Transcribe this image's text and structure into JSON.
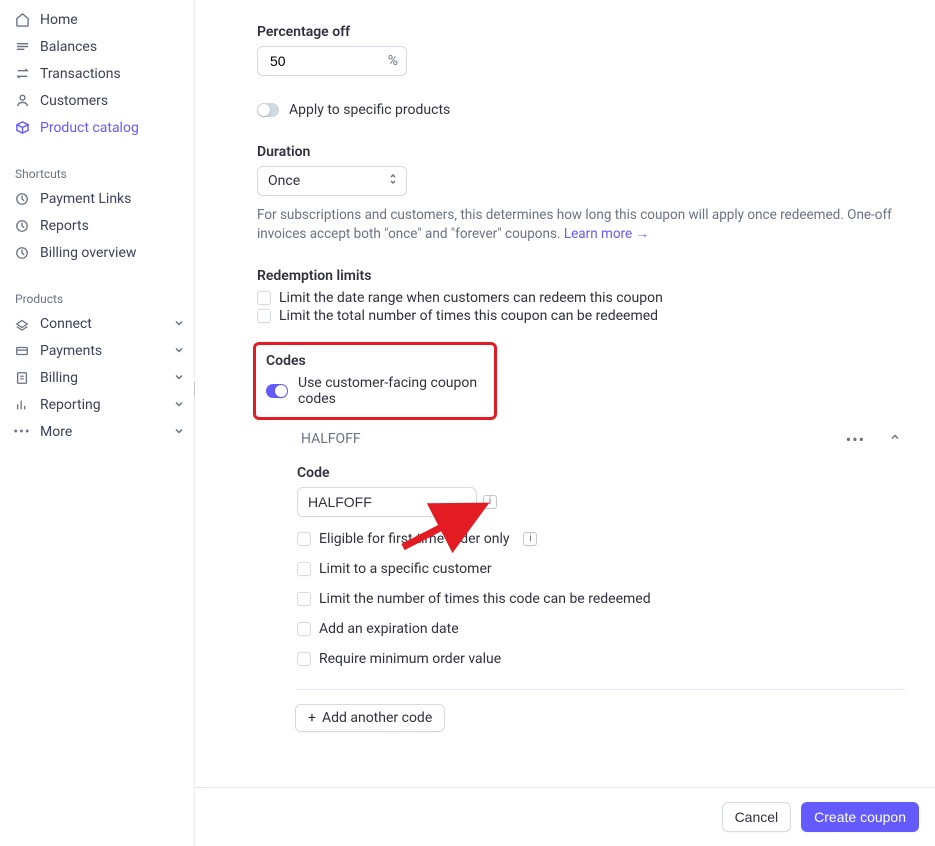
{
  "sidebar": {
    "nav": [
      {
        "label": "Home",
        "icon": "home-icon"
      },
      {
        "label": "Balances",
        "icon": "balances-icon"
      },
      {
        "label": "Transactions",
        "icon": "transactions-icon"
      },
      {
        "label": "Customers",
        "icon": "customers-icon"
      },
      {
        "label": "Product catalog",
        "icon": "product-catalog-icon",
        "active": true
      }
    ],
    "shortcuts_label": "Shortcuts",
    "shortcuts": [
      {
        "label": "Payment Links",
        "icon": "clock-icon"
      },
      {
        "label": "Reports",
        "icon": "clock-icon"
      },
      {
        "label": "Billing overview",
        "icon": "clock-icon"
      }
    ],
    "products_label": "Products",
    "products": [
      {
        "label": "Connect",
        "icon": "connect-icon"
      },
      {
        "label": "Payments",
        "icon": "payments-icon"
      },
      {
        "label": "Billing",
        "icon": "billing-icon"
      },
      {
        "label": "Reporting",
        "icon": "reporting-icon"
      },
      {
        "label": "More",
        "icon": "more-icon"
      }
    ]
  },
  "form": {
    "percentage_label": "Percentage off",
    "percentage_value": "50",
    "percentage_suffix": "%",
    "apply_specific_label": "Apply to specific products",
    "duration_label": "Duration",
    "duration_value": "Once",
    "duration_help_a": "For subscriptions and customers, this determines how long this coupon will apply once redeemed. One-off invoices accept both \"once\" and \"forever\" coupons.",
    "duration_help_link": "Learn more",
    "redemption_label": "Redemption limits",
    "redemption_cb1": "Limit the date range when customers can redeem this coupon",
    "redemption_cb2": "Limit the total number of times this coupon can be redeemed",
    "codes_label": "Codes",
    "codes_toggle_label": "Use customer-facing coupon codes",
    "code_item_name": "HALFOFF",
    "code_field_label": "Code",
    "code_value": "HALFOFF",
    "code_cb1": "Eligible for first-time order only",
    "code_cb2": "Limit to a specific customer",
    "code_cb3": "Limit the number of times this code can be redeemed",
    "code_cb4": "Add an expiration date",
    "code_cb5": "Require minimum order value",
    "add_another_label": "Add another code"
  },
  "footer": {
    "cancel": "Cancel",
    "create": "Create coupon"
  },
  "colors": {
    "accent": "#635bff",
    "highlight_border": "#e31b23"
  }
}
